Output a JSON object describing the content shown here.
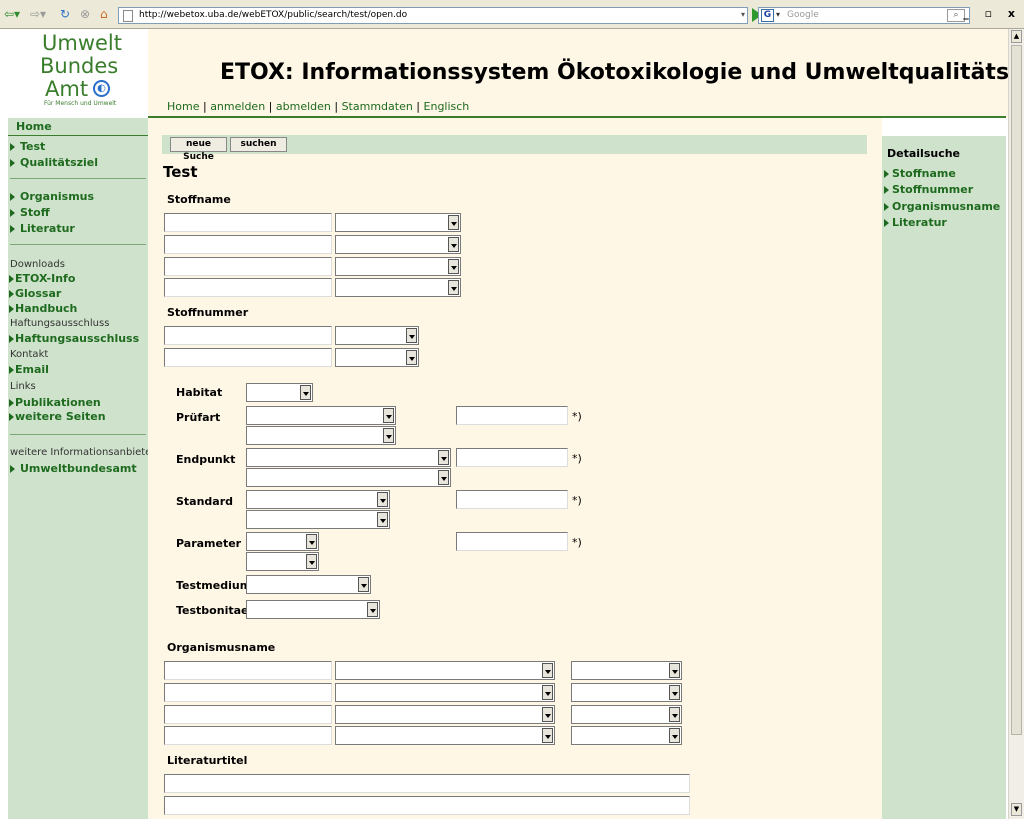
{
  "browser": {
    "url": "http://webetox.uba.de/webETOX/public/search/test/open.do",
    "search_placeholder": "Google",
    "search_engine_glyph": "G"
  },
  "logo": {
    "line1": "Umwelt",
    "line2": "Bundes",
    "line3": "Amt",
    "tagline": "Für Mensch und Umwelt"
  },
  "header": {
    "title": "ETOX: Informationssystem Ökotoxikologie und Umweltqualitätsziele",
    "nav": [
      "Home",
      "anmelden",
      "abmelden",
      "Stammdaten",
      "Englisch"
    ]
  },
  "leftnav": {
    "home": "Home",
    "group1": [
      "Test",
      "Qualitätsziel"
    ],
    "group2": [
      "Organismus",
      "Stoff",
      "Literatur"
    ],
    "downloads_label": "Downloads",
    "downloads": [
      "ETOX-Info",
      "Glossar",
      "Handbuch"
    ],
    "haftung_label": "Haftungsausschluss",
    "haftung": [
      "Haftungsausschluss"
    ],
    "kontakt_label": "Kontakt",
    "kontakt": [
      "Email"
    ],
    "links_label": "Links",
    "links": [
      "Publikationen",
      "weitere Seiten"
    ],
    "anbieter_label": "weitere Informationsanbieter",
    "anbieter": [
      "Umweltbundesamt"
    ]
  },
  "rightnav": {
    "heading": "Detailsuche",
    "items": [
      "Stoffname",
      "Stoffnummer",
      "Organismusname",
      "Literatur"
    ]
  },
  "form": {
    "new_search": "neue Suche",
    "search": "suchen",
    "title": "Test",
    "stoffname": "Stoffname",
    "stoffnummer": "Stoffnummer",
    "habitat": "Habitat",
    "pruefart": "Prüfart",
    "endpunkt": "Endpunkt",
    "standard": "Standard",
    "parameter": "Parameter",
    "testmedium": "Testmedium",
    "testbonitaet": "Testbonitaet",
    "organismusname": "Organismusname",
    "literaturtitel": "Literaturtitel",
    "footnote": "*)"
  }
}
